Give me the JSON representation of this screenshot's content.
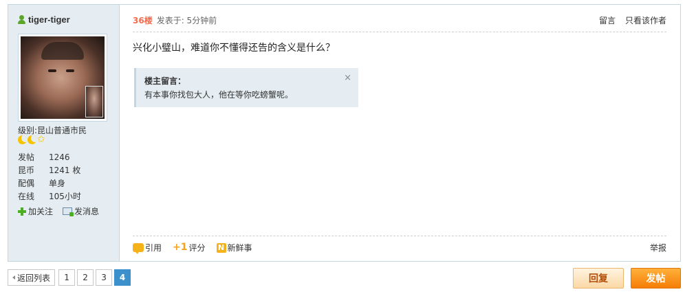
{
  "author": {
    "name": "tiger-tiger"
  },
  "profile": {
    "level_label": "级别:",
    "level_value": "昆山普通市民",
    "stats": [
      {
        "key": "发帖",
        "value": "1246"
      },
      {
        "key": "昆币",
        "value": "1241 枚"
      },
      {
        "key": "配偶",
        "value": "单身"
      },
      {
        "key": "在线",
        "value": "105小时"
      }
    ],
    "follow_label": "加关注",
    "message_label": "发消息"
  },
  "post": {
    "floor": "36楼",
    "posted_at": "发表于: 5分钟前",
    "top_links": {
      "leave_note": "留言",
      "only_author": "只看该作者"
    },
    "message": "兴化小璧山，难道你不懂得还告的含义是什么？",
    "note": {
      "title": "楼主留言：",
      "text": "有本事你找包大人，他在等你吃螃蟹呢。",
      "close": "×"
    },
    "footer": {
      "quote": "引用",
      "rate": "评分",
      "news": "新鲜事",
      "report": "举报"
    }
  },
  "pager": {
    "back_label": "返回列表",
    "pages": [
      "1",
      "2",
      "3",
      "4"
    ],
    "current": "4"
  },
  "buttons": {
    "reply": "回复",
    "post": "发帖"
  },
  "colors": {
    "accent": "#f26c4f",
    "page_current": "#3c90cc",
    "sidebar_bg": "#e5edf2",
    "post_button": "#f57d05"
  }
}
